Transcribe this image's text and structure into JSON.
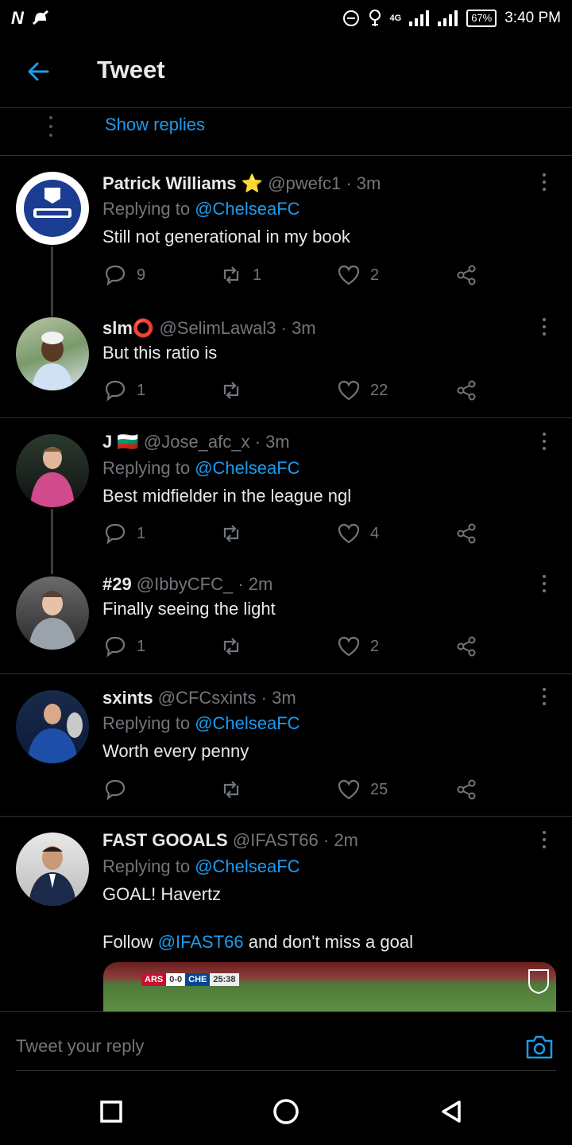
{
  "status_bar": {
    "time": "3:40 PM",
    "battery": "67%",
    "network": "4G"
  },
  "header": {
    "title": "Tweet"
  },
  "show_replies": {
    "label": "Show replies"
  },
  "tweets": [
    {
      "name": "Patrick Williams ⭐",
      "handle": "@pwefc1",
      "time": "· 3m",
      "replying_prefix": "Replying to ",
      "replying_to": "@ChelseaFC",
      "text": "Still not generational in my book",
      "replies": "9",
      "retweets": "1",
      "likes": "2",
      "avatar": "everton-crest"
    },
    {
      "name": "slm⭕",
      "handle": "@SelimLawal3",
      "time": "· 3m",
      "text": "But this ratio is",
      "replies": "1",
      "retweets": "",
      "likes": "22",
      "avatar": "person-photo"
    },
    {
      "name": "J 🇧🇬",
      "handle": "@Jose_afc_x",
      "time": "· 3m",
      "replying_prefix": "Replying to ",
      "replying_to": "@ChelseaFC",
      "text": "Best midfielder in the league ngl",
      "replies": "1",
      "retweets": "",
      "likes": "4",
      "avatar": "player-photo"
    },
    {
      "name": "#29",
      "handle": "@IbbyCFC_",
      "time": "· 2m",
      "text": "Finally seeing the light",
      "replies": "1",
      "retweets": "",
      "likes": "2",
      "avatar": "player-photo"
    },
    {
      "name": "sxints",
      "handle": "@CFCsxints",
      "time": "· 3m",
      "replying_prefix": "Replying to ",
      "replying_to": "@ChelseaFC",
      "text": "Worth every penny",
      "replies": "",
      "retweets": "",
      "likes": "25",
      "avatar": "player-photo"
    },
    {
      "name": "FAST GOOALS",
      "handle": "@IFAST66",
      "time": "· 2m",
      "replying_prefix": "Replying to ",
      "replying_to": "@ChelseaFC",
      "text": "GOAL! Havertz",
      "text2_prefix": "Follow ",
      "text2_mention": "@IFAST66",
      "text2_suffix": " and don't miss a goal",
      "avatar": "person-photo"
    }
  ],
  "media": {
    "home": "ARS",
    "score": "0-0",
    "away": "CHE",
    "clock": "25:38"
  },
  "reply_bar": {
    "placeholder": "Tweet your reply"
  },
  "colors": {
    "accent": "#1d9bf0",
    "muted": "#71767b",
    "background": "#000000"
  }
}
